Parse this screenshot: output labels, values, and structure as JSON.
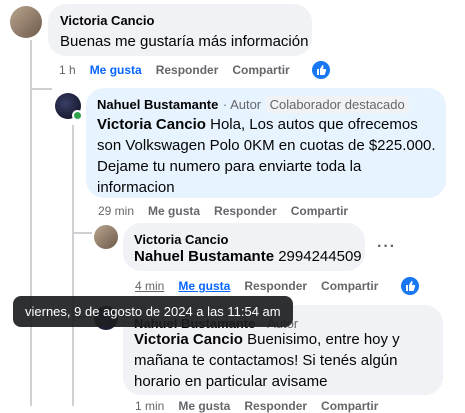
{
  "comments": [
    {
      "author": "Victoria Cancio",
      "text": "Buenas me gustaría más información",
      "time": "1 h",
      "like": "Me gusta",
      "reply": "Responder",
      "share": "Compartir"
    },
    {
      "author": "Nahuel Bustamante",
      "role": "Autor",
      "badge": "Colaborador destacado",
      "mention": "Victoria Cancio",
      "text": " Hola, Los autos que ofrecemos son Volkswagen Polo 0KM en cuotas de $225.000. Dejame tu numero para enviarte toda la informacion",
      "time": "29 min",
      "like": "Me gusta",
      "reply": "Responder",
      "share": "Compartir"
    },
    {
      "author": "Victoria Cancio",
      "mention": "Nahuel Bustamante",
      "text": " 2994244509",
      "time": "4 min",
      "like": "Me gusta",
      "reply": "Responder",
      "share": "Compartir",
      "more": "···"
    },
    {
      "author": "Nahuel Bustamante",
      "role": "Autor",
      "mention": "Victoria Cancio",
      "text": " Buenisimo, entre hoy y mañana te contactamos! Si tenés algún horario en particular avisame",
      "time": "1 min",
      "like": "Me gusta",
      "reply": "Responder",
      "share": "Compartir"
    }
  ],
  "tooltip": "viernes, 9 de agosto de 2024 a las 11:54 am",
  "colors": {
    "accent": "#0866ff",
    "bubble": "#f0f2f5",
    "highlight": "#e7f3ff"
  }
}
